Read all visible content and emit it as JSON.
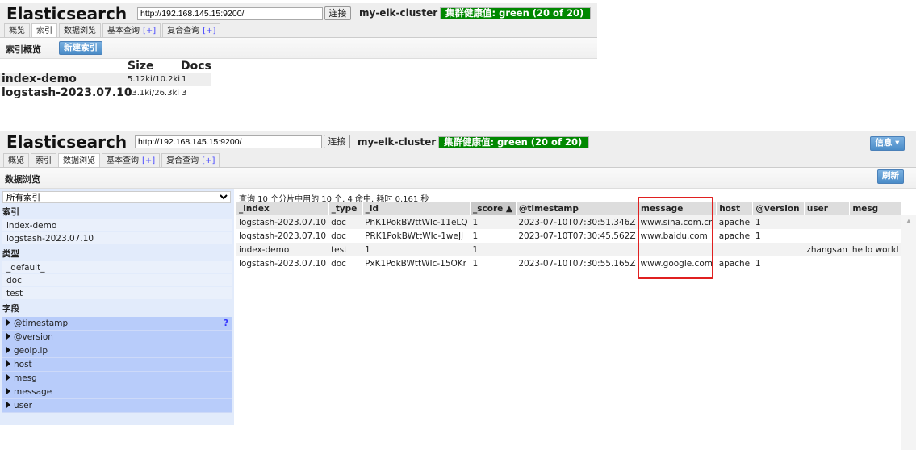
{
  "top": {
    "app_title": "Elasticsearch",
    "url": "http://192.168.145.15:9200/",
    "connect": "连接",
    "cluster": "my-elk-cluster",
    "health": "集群健康值: green (20 of 20)",
    "tabs": [
      {
        "label": "概览"
      },
      {
        "label": "索引",
        "active": true
      },
      {
        "label": "数据浏览"
      },
      {
        "label": "基本查询",
        "plus": "[+]"
      },
      {
        "label": "复合查询",
        "plus": "[+]"
      }
    ],
    "toolbar_title": "索引概览",
    "new_index": "新建索引",
    "columns": [
      "Size",
      "Docs"
    ],
    "rows": [
      {
        "name": "index-demo",
        "size": "5.12ki/10.2ki",
        "docs": "1"
      },
      {
        "name": "logstash-2023.07.10",
        "size": "13.1ki/26.3ki",
        "docs": "3"
      }
    ]
  },
  "bottom": {
    "app_title": "Elasticsearch",
    "url": "http://192.168.145.15:9200/",
    "connect": "连接",
    "cluster": "my-elk-cluster",
    "health": "集群健康值: green (20 of 20)",
    "info": "信息 ▾",
    "tabs": [
      {
        "label": "概览"
      },
      {
        "label": "索引"
      },
      {
        "label": "数据浏览",
        "active": true
      },
      {
        "label": "基本查询",
        "plus": "[+]"
      },
      {
        "label": "复合查询",
        "plus": "[+]"
      }
    ],
    "toolbar_title": "数据浏览",
    "refresh": "刷新",
    "sidebar": {
      "select": "所有索引",
      "index_head": "索引",
      "indices": [
        "index-demo",
        "logstash-2023.07.10"
      ],
      "type_head": "类型",
      "types": [
        "_default_",
        "doc",
        "test"
      ],
      "field_head": "字段",
      "fields": [
        "@timestamp",
        "@version",
        "geoip.ip",
        "host",
        "mesg",
        "message",
        "user"
      ],
      "help": "?"
    },
    "summary": "查询 10 个分片中用的 10 个. 4 命中. 耗时 0.161 秒",
    "columns": [
      "_index",
      "_type",
      "_id",
      "_score ▲",
      "@timestamp",
      "message",
      "host",
      "@version",
      "user",
      "mesg"
    ],
    "rows": [
      [
        "logstash-2023.07.10",
        "doc",
        "PhK1PokBWttWIc-11eLQ",
        "1",
        "2023-07-10T07:30:51.346Z",
        "www.sina.com.cn",
        "apache",
        "1",
        "",
        ""
      ],
      [
        "logstash-2023.07.10",
        "doc",
        "PRK1PokBWttWIc-1weJJ",
        "1",
        "2023-07-10T07:30:45.562Z",
        "www.baidu.com",
        "apache",
        "1",
        "",
        ""
      ],
      [
        "index-demo",
        "test",
        "1",
        "1",
        "",
        "",
        "",
        "",
        "zhangsan",
        "hello world"
      ],
      [
        "logstash-2023.07.10",
        "doc",
        "PxK1PokBWttWIc-15OKr",
        "1",
        "2023-07-10T07:30:55.165Z",
        "www.google.com",
        "apache",
        "1",
        "",
        ""
      ]
    ],
    "highlight_color": "#e02020"
  }
}
